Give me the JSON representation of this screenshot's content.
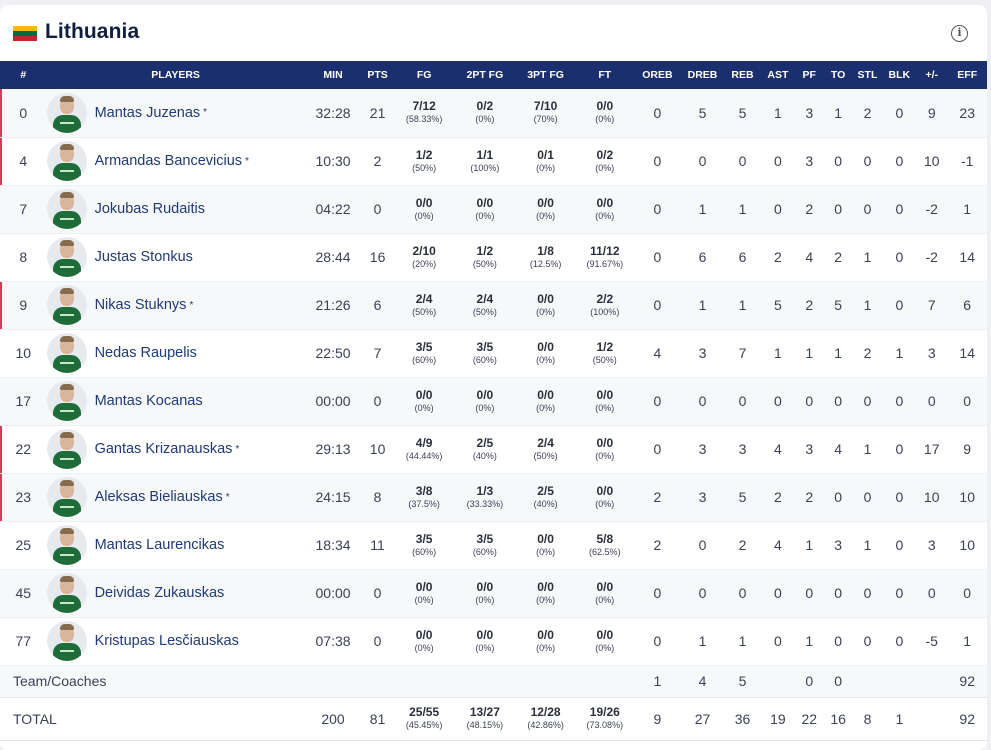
{
  "team": {
    "name": "Lithuania",
    "flag_colors": [
      "#fdb913",
      "#006a44",
      "#c1272d"
    ],
    "info_icon": "info-icon"
  },
  "columns": [
    "#",
    "PLAYERS",
    "MIN",
    "PTS",
    "FG",
    "2PT FG",
    "3PT FG",
    "FT",
    "OREB",
    "DREB",
    "REB",
    "AST",
    "PF",
    "TO",
    "STL",
    "BLK",
    "+/-",
    "EFF"
  ],
  "accent": {
    "header_bg": "#1b2f6e",
    "starter_marker": "#d53a59"
  },
  "players": [
    {
      "num": "0",
      "name": "Mantas Juzenas",
      "starter": true,
      "min": "32:28",
      "pts": "21",
      "fg": "7/12",
      "fg_pct": "(58.33%)",
      "fg2": "0/2",
      "fg2_pct": "(0%)",
      "fg3": "7/10",
      "fg3_pct": "(70%)",
      "ft": "0/0",
      "ft_pct": "(0%)",
      "oreb": "0",
      "dreb": "5",
      "reb": "5",
      "ast": "1",
      "pf": "3",
      "to": "1",
      "stl": "2",
      "blk": "0",
      "pm": "9",
      "eff": "23"
    },
    {
      "num": "4",
      "name": "Armandas Bancevicius",
      "starter": true,
      "min": "10:30",
      "pts": "2",
      "fg": "1/2",
      "fg_pct": "(50%)",
      "fg2": "1/1",
      "fg2_pct": "(100%)",
      "fg3": "0/1",
      "fg3_pct": "(0%)",
      "ft": "0/2",
      "ft_pct": "(0%)",
      "oreb": "0",
      "dreb": "0",
      "reb": "0",
      "ast": "0",
      "pf": "3",
      "to": "0",
      "stl": "0",
      "blk": "0",
      "pm": "10",
      "eff": "-1"
    },
    {
      "num": "7",
      "name": "Jokubas Rudaitis",
      "starter": false,
      "min": "04:22",
      "pts": "0",
      "fg": "0/0",
      "fg_pct": "(0%)",
      "fg2": "0/0",
      "fg2_pct": "(0%)",
      "fg3": "0/0",
      "fg3_pct": "(0%)",
      "ft": "0/0",
      "ft_pct": "(0%)",
      "oreb": "0",
      "dreb": "1",
      "reb": "1",
      "ast": "0",
      "pf": "2",
      "to": "0",
      "stl": "0",
      "blk": "0",
      "pm": "-2",
      "eff": "1"
    },
    {
      "num": "8",
      "name": "Justas Stonkus",
      "starter": false,
      "min": "28:44",
      "pts": "16",
      "fg": "2/10",
      "fg_pct": "(20%)",
      "fg2": "1/2",
      "fg2_pct": "(50%)",
      "fg3": "1/8",
      "fg3_pct": "(12.5%)",
      "ft": "11/12",
      "ft_pct": "(91.67%)",
      "oreb": "0",
      "dreb": "6",
      "reb": "6",
      "ast": "2",
      "pf": "4",
      "to": "2",
      "stl": "1",
      "blk": "0",
      "pm": "-2",
      "eff": "14"
    },
    {
      "num": "9",
      "name": "Nikas Stuknys",
      "starter": true,
      "min": "21:26",
      "pts": "6",
      "fg": "2/4",
      "fg_pct": "(50%)",
      "fg2": "2/4",
      "fg2_pct": "(50%)",
      "fg3": "0/0",
      "fg3_pct": "(0%)",
      "ft": "2/2",
      "ft_pct": "(100%)",
      "oreb": "0",
      "dreb": "1",
      "reb": "1",
      "ast": "5",
      "pf": "2",
      "to": "5",
      "stl": "1",
      "blk": "0",
      "pm": "7",
      "eff": "6"
    },
    {
      "num": "10",
      "name": "Nedas Raupelis",
      "starter": false,
      "min": "22:50",
      "pts": "7",
      "fg": "3/5",
      "fg_pct": "(60%)",
      "fg2": "3/5",
      "fg2_pct": "(60%)",
      "fg3": "0/0",
      "fg3_pct": "(0%)",
      "ft": "1/2",
      "ft_pct": "(50%)",
      "oreb": "4",
      "dreb": "3",
      "reb": "7",
      "ast": "1",
      "pf": "1",
      "to": "1",
      "stl": "2",
      "blk": "1",
      "pm": "3",
      "eff": "14"
    },
    {
      "num": "17",
      "name": "Mantas Kocanas",
      "starter": false,
      "min": "00:00",
      "pts": "0",
      "fg": "0/0",
      "fg_pct": "(0%)",
      "fg2": "0/0",
      "fg2_pct": "(0%)",
      "fg3": "0/0",
      "fg3_pct": "(0%)",
      "ft": "0/0",
      "ft_pct": "(0%)",
      "oreb": "0",
      "dreb": "0",
      "reb": "0",
      "ast": "0",
      "pf": "0",
      "to": "0",
      "stl": "0",
      "blk": "0",
      "pm": "0",
      "eff": "0"
    },
    {
      "num": "22",
      "name": "Gantas Krizanauskas",
      "starter": true,
      "min": "29:13",
      "pts": "10",
      "fg": "4/9",
      "fg_pct": "(44.44%)",
      "fg2": "2/5",
      "fg2_pct": "(40%)",
      "fg3": "2/4",
      "fg3_pct": "(50%)",
      "ft": "0/0",
      "ft_pct": "(0%)",
      "oreb": "0",
      "dreb": "3",
      "reb": "3",
      "ast": "4",
      "pf": "3",
      "to": "4",
      "stl": "1",
      "blk": "0",
      "pm": "17",
      "eff": "9"
    },
    {
      "num": "23",
      "name": "Aleksas Bieliauskas",
      "starter": true,
      "min": "24:15",
      "pts": "8",
      "fg": "3/8",
      "fg_pct": "(37.5%)",
      "fg2": "1/3",
      "fg2_pct": "(33.33%)",
      "fg3": "2/5",
      "fg3_pct": "(40%)",
      "ft": "0/0",
      "ft_pct": "(0%)",
      "oreb": "2",
      "dreb": "3",
      "reb": "5",
      "ast": "2",
      "pf": "2",
      "to": "0",
      "stl": "0",
      "blk": "0",
      "pm": "10",
      "eff": "10"
    },
    {
      "num": "25",
      "name": "Mantas Laurencikas",
      "starter": false,
      "min": "18:34",
      "pts": "11",
      "fg": "3/5",
      "fg_pct": "(60%)",
      "fg2": "3/5",
      "fg2_pct": "(60%)",
      "fg3": "0/0",
      "fg3_pct": "(0%)",
      "ft": "5/8",
      "ft_pct": "(62.5%)",
      "oreb": "2",
      "dreb": "0",
      "reb": "2",
      "ast": "4",
      "pf": "1",
      "to": "3",
      "stl": "1",
      "blk": "0",
      "pm": "3",
      "eff": "10"
    },
    {
      "num": "45",
      "name": "Deividas Zukauskas",
      "starter": false,
      "min": "00:00",
      "pts": "0",
      "fg": "0/0",
      "fg_pct": "(0%)",
      "fg2": "0/0",
      "fg2_pct": "(0%)",
      "fg3": "0/0",
      "fg3_pct": "(0%)",
      "ft": "0/0",
      "ft_pct": "(0%)",
      "oreb": "0",
      "dreb": "0",
      "reb": "0",
      "ast": "0",
      "pf": "0",
      "to": "0",
      "stl": "0",
      "blk": "0",
      "pm": "0",
      "eff": "0"
    },
    {
      "num": "77",
      "name": "Kristupas Lesčiauskas",
      "starter": false,
      "min": "07:38",
      "pts": "0",
      "fg": "0/0",
      "fg_pct": "(0%)",
      "fg2": "0/0",
      "fg2_pct": "(0%)",
      "fg3": "0/0",
      "fg3_pct": "(0%)",
      "ft": "0/0",
      "ft_pct": "(0%)",
      "oreb": "0",
      "dreb": "1",
      "reb": "1",
      "ast": "0",
      "pf": "1",
      "to": "0",
      "stl": "0",
      "blk": "0",
      "pm": "-5",
      "eff": "1"
    }
  ],
  "team_row": {
    "label": "Team/Coaches",
    "oreb": "1",
    "dreb": "4",
    "reb": "5",
    "pf": "0",
    "to": "0",
    "eff": "92"
  },
  "total_row": {
    "label": "TOTAL",
    "min": "200",
    "pts": "81",
    "fg": "25/55",
    "fg_pct": "(45.45%)",
    "fg2": "13/27",
    "fg2_pct": "(48.15%)",
    "fg3": "12/28",
    "fg3_pct": "(42.86%)",
    "ft": "19/26",
    "ft_pct": "(73.08%)",
    "oreb": "9",
    "dreb": "27",
    "reb": "36",
    "ast": "19",
    "pf": "22",
    "to": "16",
    "stl": "8",
    "blk": "1",
    "eff": "92"
  }
}
